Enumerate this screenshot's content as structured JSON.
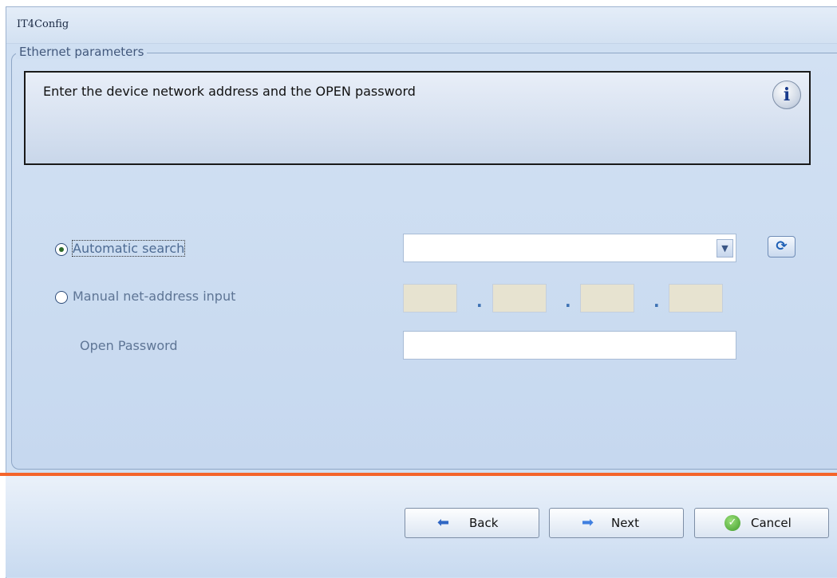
{
  "window": {
    "title": "IT4Config"
  },
  "group": {
    "legend": "Ethernet parameters",
    "info_text": "Enter the device network address and the OPEN password",
    "info_icon": "info-icon"
  },
  "options": {
    "automatic_search": {
      "label": "Automatic search",
      "selected": true
    },
    "manual_input": {
      "label": "Manual net-address input",
      "selected": false
    },
    "ip_separator": "."
  },
  "fields": {
    "device_select": {
      "value": ""
    },
    "ip_octets": [
      "",
      "",
      "",
      ""
    ],
    "open_password": {
      "label": "Open Password",
      "value": ""
    }
  },
  "buttons": {
    "back": "Back",
    "next": "Next",
    "cancel": "Cancel"
  },
  "colors": {
    "accent_separator": "#f4642b",
    "background": "#cfdff2"
  }
}
